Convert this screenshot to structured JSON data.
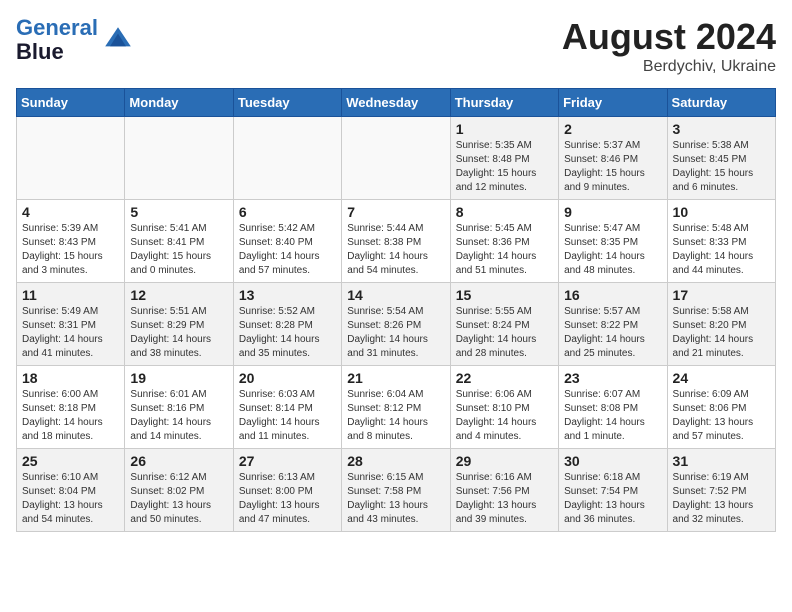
{
  "header": {
    "logo_line1": "General",
    "logo_line2": "Blue",
    "month_year": "August 2024",
    "location": "Berdychiv, Ukraine"
  },
  "weekdays": [
    "Sunday",
    "Monday",
    "Tuesday",
    "Wednesday",
    "Thursday",
    "Friday",
    "Saturday"
  ],
  "weeks": [
    [
      {
        "day": "",
        "info": ""
      },
      {
        "day": "",
        "info": ""
      },
      {
        "day": "",
        "info": ""
      },
      {
        "day": "",
        "info": ""
      },
      {
        "day": "1",
        "info": "Sunrise: 5:35 AM\nSunset: 8:48 PM\nDaylight: 15 hours\nand 12 minutes."
      },
      {
        "day": "2",
        "info": "Sunrise: 5:37 AM\nSunset: 8:46 PM\nDaylight: 15 hours\nand 9 minutes."
      },
      {
        "day": "3",
        "info": "Sunrise: 5:38 AM\nSunset: 8:45 PM\nDaylight: 15 hours\nand 6 minutes."
      }
    ],
    [
      {
        "day": "4",
        "info": "Sunrise: 5:39 AM\nSunset: 8:43 PM\nDaylight: 15 hours\nand 3 minutes."
      },
      {
        "day": "5",
        "info": "Sunrise: 5:41 AM\nSunset: 8:41 PM\nDaylight: 15 hours\nand 0 minutes."
      },
      {
        "day": "6",
        "info": "Sunrise: 5:42 AM\nSunset: 8:40 PM\nDaylight: 14 hours\nand 57 minutes."
      },
      {
        "day": "7",
        "info": "Sunrise: 5:44 AM\nSunset: 8:38 PM\nDaylight: 14 hours\nand 54 minutes."
      },
      {
        "day": "8",
        "info": "Sunrise: 5:45 AM\nSunset: 8:36 PM\nDaylight: 14 hours\nand 51 minutes."
      },
      {
        "day": "9",
        "info": "Sunrise: 5:47 AM\nSunset: 8:35 PM\nDaylight: 14 hours\nand 48 minutes."
      },
      {
        "day": "10",
        "info": "Sunrise: 5:48 AM\nSunset: 8:33 PM\nDaylight: 14 hours\nand 44 minutes."
      }
    ],
    [
      {
        "day": "11",
        "info": "Sunrise: 5:49 AM\nSunset: 8:31 PM\nDaylight: 14 hours\nand 41 minutes."
      },
      {
        "day": "12",
        "info": "Sunrise: 5:51 AM\nSunset: 8:29 PM\nDaylight: 14 hours\nand 38 minutes."
      },
      {
        "day": "13",
        "info": "Sunrise: 5:52 AM\nSunset: 8:28 PM\nDaylight: 14 hours\nand 35 minutes."
      },
      {
        "day": "14",
        "info": "Sunrise: 5:54 AM\nSunset: 8:26 PM\nDaylight: 14 hours\nand 31 minutes."
      },
      {
        "day": "15",
        "info": "Sunrise: 5:55 AM\nSunset: 8:24 PM\nDaylight: 14 hours\nand 28 minutes."
      },
      {
        "day": "16",
        "info": "Sunrise: 5:57 AM\nSunset: 8:22 PM\nDaylight: 14 hours\nand 25 minutes."
      },
      {
        "day": "17",
        "info": "Sunrise: 5:58 AM\nSunset: 8:20 PM\nDaylight: 14 hours\nand 21 minutes."
      }
    ],
    [
      {
        "day": "18",
        "info": "Sunrise: 6:00 AM\nSunset: 8:18 PM\nDaylight: 14 hours\nand 18 minutes."
      },
      {
        "day": "19",
        "info": "Sunrise: 6:01 AM\nSunset: 8:16 PM\nDaylight: 14 hours\nand 14 minutes."
      },
      {
        "day": "20",
        "info": "Sunrise: 6:03 AM\nSunset: 8:14 PM\nDaylight: 14 hours\nand 11 minutes."
      },
      {
        "day": "21",
        "info": "Sunrise: 6:04 AM\nSunset: 8:12 PM\nDaylight: 14 hours\nand 8 minutes."
      },
      {
        "day": "22",
        "info": "Sunrise: 6:06 AM\nSunset: 8:10 PM\nDaylight: 14 hours\nand 4 minutes."
      },
      {
        "day": "23",
        "info": "Sunrise: 6:07 AM\nSunset: 8:08 PM\nDaylight: 14 hours\nand 1 minute."
      },
      {
        "day": "24",
        "info": "Sunrise: 6:09 AM\nSunset: 8:06 PM\nDaylight: 13 hours\nand 57 minutes."
      }
    ],
    [
      {
        "day": "25",
        "info": "Sunrise: 6:10 AM\nSunset: 8:04 PM\nDaylight: 13 hours\nand 54 minutes."
      },
      {
        "day": "26",
        "info": "Sunrise: 6:12 AM\nSunset: 8:02 PM\nDaylight: 13 hours\nand 50 minutes."
      },
      {
        "day": "27",
        "info": "Sunrise: 6:13 AM\nSunset: 8:00 PM\nDaylight: 13 hours\nand 47 minutes."
      },
      {
        "day": "28",
        "info": "Sunrise: 6:15 AM\nSunset: 7:58 PM\nDaylight: 13 hours\nand 43 minutes."
      },
      {
        "day": "29",
        "info": "Sunrise: 6:16 AM\nSunset: 7:56 PM\nDaylight: 13 hours\nand 39 minutes."
      },
      {
        "day": "30",
        "info": "Sunrise: 6:18 AM\nSunset: 7:54 PM\nDaylight: 13 hours\nand 36 minutes."
      },
      {
        "day": "31",
        "info": "Sunrise: 6:19 AM\nSunset: 7:52 PM\nDaylight: 13 hours\nand 32 minutes."
      }
    ]
  ]
}
